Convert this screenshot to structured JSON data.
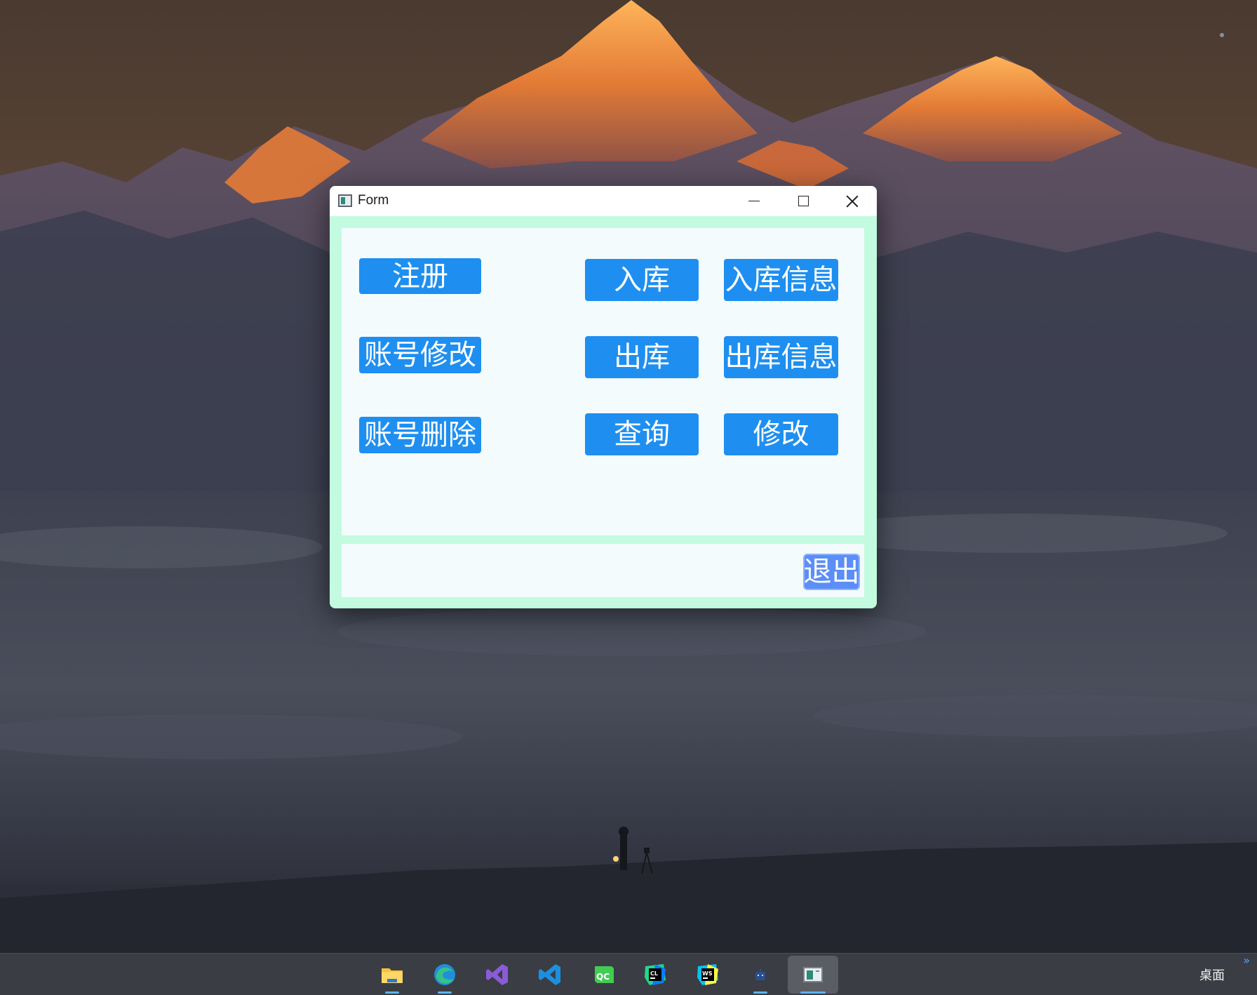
{
  "window": {
    "title": "Form",
    "buttons": {
      "register": "注册",
      "account_modify": "账号修改",
      "account_delete": "账号删除",
      "stock_in": "入库",
      "stock_in_info": "入库信息",
      "stock_out": "出库",
      "stock_out_info": "出库信息",
      "query": "查询",
      "modify": "修改",
      "exit": "退出"
    }
  },
  "taskbar": {
    "apps": [
      {
        "icon": "file-explorer-icon"
      },
      {
        "icon": "edge-browser-icon"
      },
      {
        "icon": "visual-studio-icon"
      },
      {
        "icon": "vscode-icon"
      },
      {
        "icon": "qt-creator-icon"
      },
      {
        "icon": "clion-icon"
      },
      {
        "icon": "webstorm-icon"
      },
      {
        "icon": "app-icon"
      },
      {
        "icon": "form-window-icon"
      }
    ],
    "desktop_label": "桌面"
  },
  "colors": {
    "button_blue": "#1e8ff0",
    "exit_button": "#5b8ef6",
    "window_frame": "#c2fbdf",
    "panel_bg": "#f3fbfd",
    "taskbar_bg": "#3a3d44"
  }
}
